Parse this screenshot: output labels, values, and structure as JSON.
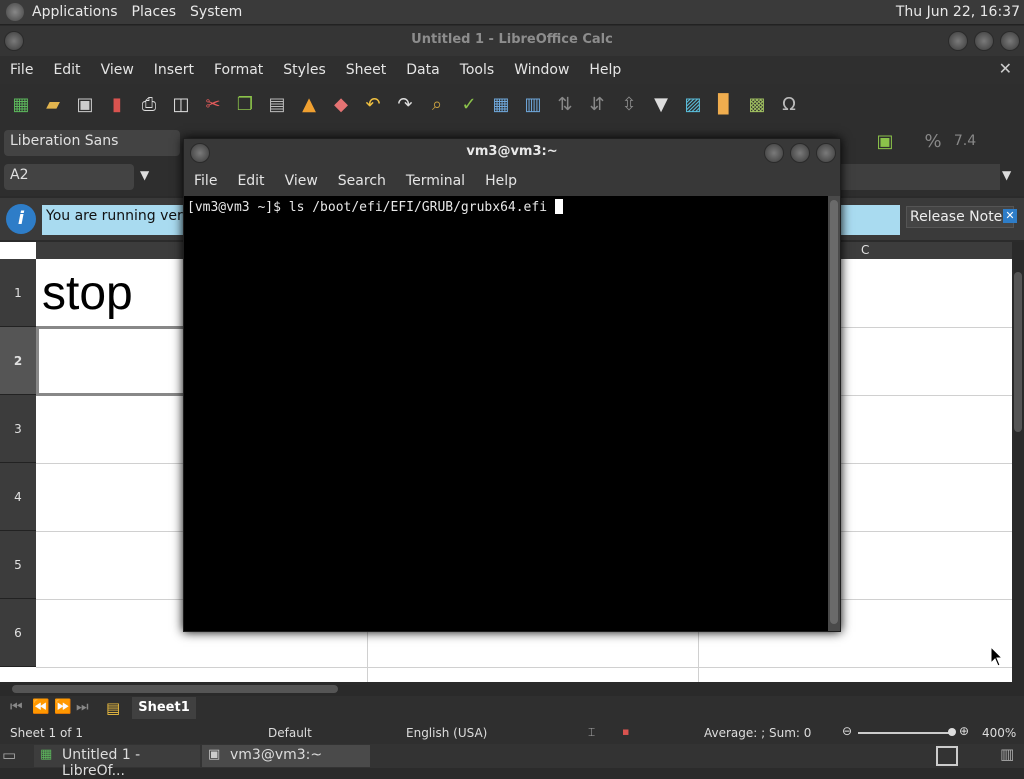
{
  "panel": {
    "menus": [
      "Applications",
      "Places",
      "System"
    ],
    "clock": "Thu Jun 22, 16:37"
  },
  "calc": {
    "title": "Untitled 1 - LibreOffice Calc",
    "menus": [
      "File",
      "Edit",
      "View",
      "Insert",
      "Format",
      "Styles",
      "Sheet",
      "Data",
      "Tools",
      "Window",
      "Help"
    ],
    "font_name": "Liberation Sans",
    "name_box": "A2",
    "infobar_text": "You are running version",
    "release_notes": "Release Notes",
    "col_header_c": "C",
    "rows": [
      "1",
      "2",
      "3",
      "4",
      "5",
      "6"
    ],
    "cell_a1": "stop",
    "sheet_tab": "Sheet1",
    "status": {
      "sheet": "Sheet 1 of 1",
      "style": "Default",
      "language": "English (USA)",
      "sum": "Average: ; Sum: 0",
      "zoom": "400%"
    }
  },
  "terminal": {
    "title": "vm3@vm3:~",
    "menus": [
      "File",
      "Edit",
      "View",
      "Search",
      "Terminal",
      "Help"
    ],
    "prompt_line": "[vm3@vm3 ~]$ ls /boot/efi/EFI/GRUB/grubx64.efi "
  },
  "taskbar": {
    "items": [
      "Untitled 1 - LibreOf...",
      "vm3@vm3:~"
    ]
  }
}
